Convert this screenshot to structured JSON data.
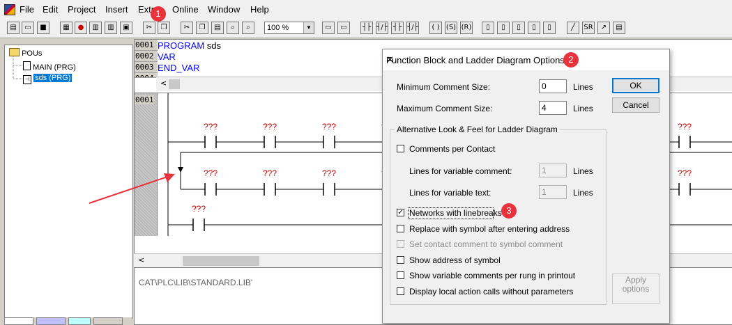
{
  "menu": [
    "File",
    "Edit",
    "Project",
    "Insert",
    "Extras",
    "Online",
    "Window",
    "Help"
  ],
  "toolbar": {
    "zoom_value": "100 %"
  },
  "tree": {
    "root": "POUs",
    "items": [
      "MAIN (PRG)",
      "sds (PRG)"
    ]
  },
  "declaration": {
    "line_numbers": [
      "0001",
      "0002",
      "0003",
      "0004"
    ],
    "lines": [
      "PROGRAM",
      "sds",
      "VAR",
      "END_VAR"
    ]
  },
  "ladder": {
    "network_number": "0001",
    "placeholder": "???"
  },
  "messages": {
    "text": "CAT\\PLC\\LIB\\STANDARD.LIB'"
  },
  "dialog": {
    "title": "Function Block and Ladder Diagram Options",
    "min_comment_label": "Minimum Comment Size:",
    "min_comment_value": "0",
    "max_comment_label": "Maximum Comment Size:",
    "max_comment_value": "4",
    "lines_unit": "Lines",
    "ok_label": "OK",
    "cancel_label": "Cancel",
    "group_label": "Alternative Look & Feel for Ladder Diagram",
    "comments_per_contact": "Comments per Contact",
    "lines_var_comment_label": "Lines for variable comment:",
    "lines_var_comment_value": "1",
    "lines_var_text_label": "Lines for variable text:",
    "lines_var_text_value": "1",
    "networks_linebreaks": "Networks with linebreaks",
    "replace_symbol": "Replace with symbol after entering address",
    "set_contact_comment": "Set contact comment to symbol comment",
    "show_address": "Show address of symbol",
    "show_var_comments": "Show variable comments per rung in printout",
    "display_local_action": "Display local action calls without parameters",
    "apply_label_1": "Apply",
    "apply_label_2": "options"
  },
  "badges": [
    "1",
    "2",
    "3"
  ],
  "colors": {
    "accent": "#0078d7",
    "annotation": "#e8323c",
    "code_blue": "#0000ff",
    "placeholder_red": "#cc0000"
  }
}
